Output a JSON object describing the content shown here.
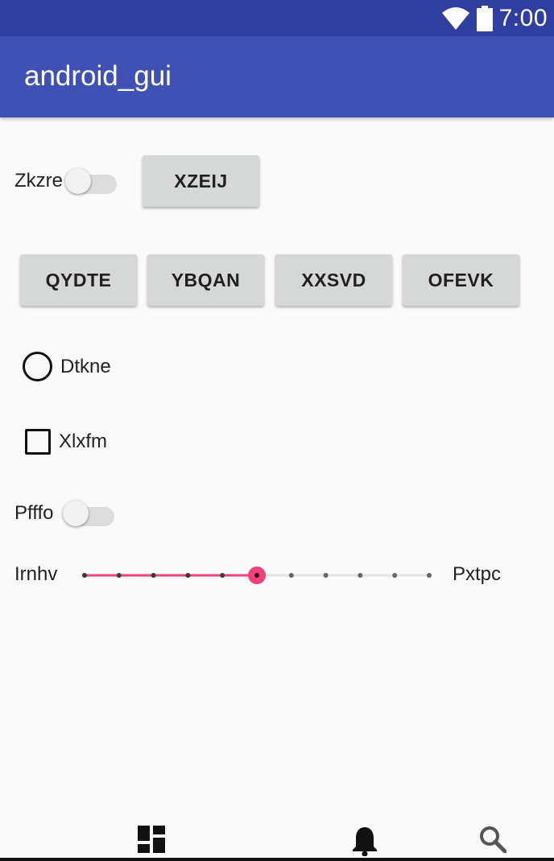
{
  "status_bar": {
    "time": "7:00",
    "icons": [
      "wifi-icon",
      "battery-icon"
    ]
  },
  "app_bar": {
    "title": "android_gui"
  },
  "row1": {
    "switch_label": "Zkzre",
    "switch_on": false,
    "button_label": "XZEIJ"
  },
  "button_row": [
    "QYDTE",
    "YBQAN",
    "XXSVD",
    "OFEVK"
  ],
  "radio": {
    "label": "Dtkne",
    "checked": false
  },
  "checkbox": {
    "label": "Xlxfm",
    "checked": false
  },
  "switch2": {
    "label": "Pfffo",
    "on": false
  },
  "slider": {
    "left_label": "Irnhv",
    "right_label": "Pxtpc",
    "min": 0,
    "max": 10,
    "value": 5,
    "accent": "#f0427b"
  },
  "bottom_nav": {
    "icons": [
      "dashboard-icon",
      "notifications-icon",
      "search-icon"
    ]
  },
  "colors": {
    "status_bar": "#303f9f",
    "app_bar": "#3f51b5",
    "accent": "#f0427b"
  }
}
